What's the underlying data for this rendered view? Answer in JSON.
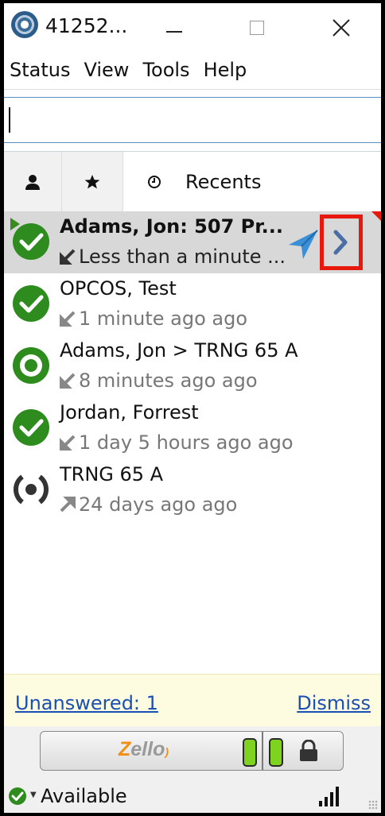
{
  "window": {
    "title": "41252...",
    "controls": {
      "minimize": "—",
      "maximize": "☐",
      "close": "✕"
    }
  },
  "menu": [
    "Status",
    "View",
    "Tools",
    "Help"
  ],
  "search": {
    "value": "",
    "placeholder": ""
  },
  "tabs": {
    "contacts_icon": "person-icon",
    "favorites_icon": "star-icon",
    "recents_icon": "clock-icon",
    "recents_label": "Recents"
  },
  "recents": [
    {
      "name": "Adams, Jon: 507 Pr...",
      "time": "Less than a minute ...",
      "status": "online",
      "direction": "incoming",
      "selected": true
    },
    {
      "name": "OPCOS, Test",
      "time": "1 minute ago ago",
      "status": "online",
      "direction": "incoming",
      "selected": false
    },
    {
      "name": "Adams, Jon > TRNG 65 A",
      "time": "8 minutes ago ago",
      "status": "channel-online",
      "direction": "incoming",
      "selected": false
    },
    {
      "name": "Jordan, Forrest",
      "time": "1 day 5 hours ago ago",
      "status": "online",
      "direction": "incoming",
      "selected": false
    },
    {
      "name": "TRNG 65 A",
      "time": "24 days ago ago",
      "status": "channel-offline",
      "direction": "outgoing",
      "selected": false
    }
  ],
  "notification": {
    "unanswered": "Unanswered: 1",
    "dismiss": "Dismiss"
  },
  "ptt": {
    "logo_z": "Z",
    "logo_rest": "ello"
  },
  "statusbar": {
    "status": "Available"
  },
  "colors": {
    "online": "#2e8b1e",
    "offline": "#333333",
    "link": "#1a4fb5",
    "highlight": "#e8180c",
    "accent": "#3b8fd6"
  }
}
